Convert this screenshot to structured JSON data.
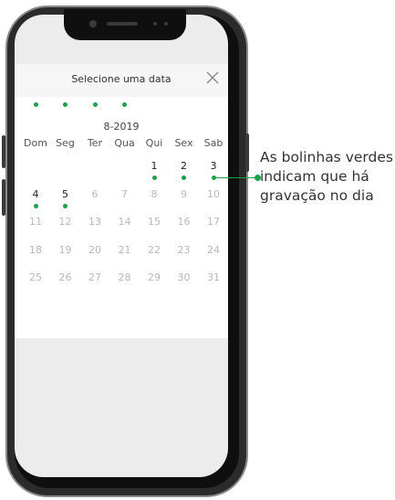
{
  "modal": {
    "title": "Selecione uma data"
  },
  "calendar": {
    "month_label": "8-2019",
    "weekdays": [
      "Dom",
      "Seg",
      "Ter",
      "Qua",
      "Qui",
      "Sex",
      "Sab"
    ],
    "days": [
      "1",
      "2",
      "3",
      "4",
      "5",
      "6",
      "7",
      "8",
      "9",
      "10",
      "11",
      "12",
      "13",
      "14",
      "15",
      "16",
      "17",
      "18",
      "19",
      "20",
      "21",
      "22",
      "23",
      "24",
      "25",
      "26",
      "27",
      "28",
      "29",
      "30",
      "31"
    ],
    "first_weekday_index": 4,
    "days_with_recording": [
      "1",
      "2",
      "3",
      "4",
      "5"
    ],
    "active_days": [
      "1",
      "2",
      "3",
      "4",
      "5"
    ]
  },
  "annotation": {
    "lines": [
      "As bolinhas verdes",
      "indicam que há",
      "gravação no dia"
    ]
  },
  "colors": {
    "recording_dot": "#1aa34a",
    "active_day_text": "#222222",
    "inactive_day_text": "#b8b8b8"
  },
  "icons": {
    "close": "close-icon"
  }
}
